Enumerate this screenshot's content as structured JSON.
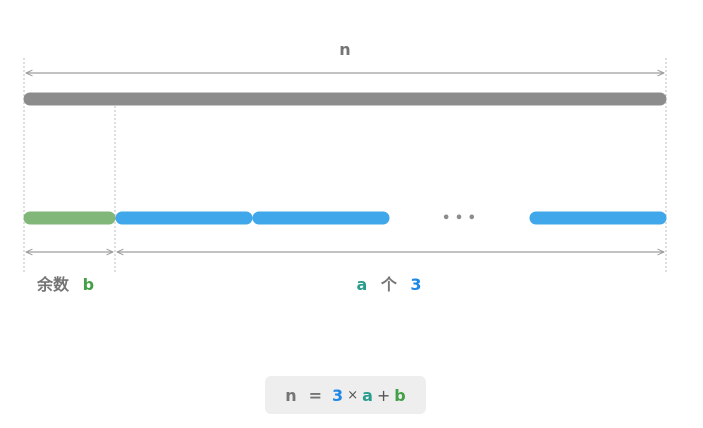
{
  "top_label": "n",
  "remainder_label": "余数",
  "remainder_var": "b",
  "count_var": "a",
  "count_word": "个",
  "count_num": "3",
  "ellipsis": "• • •",
  "formula": {
    "lhs": "n",
    "eq": "=",
    "three": "3",
    "times": "×",
    "a": "a",
    "plus": "+",
    "b": "b"
  },
  "colors": {
    "total_bar": "#8c8c8c",
    "remainder_bar": "#82b77a",
    "segment_bar": "#3fa7ea",
    "label_gray": "#757575",
    "var_green": "#43a047",
    "var_teal": "#2a9d8f",
    "num_blue": "#1e88e5"
  }
}
